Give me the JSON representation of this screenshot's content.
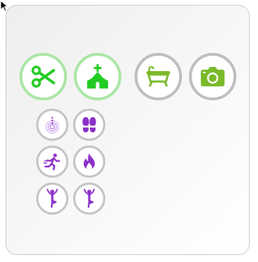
{
  "colors": {
    "active_icon": "#22cc22",
    "inactive_icon": "#7ab92a",
    "active_ring": "#a9e6a4",
    "inactive_ring": "#bdbdbd",
    "small_icon": "#8b2fc9",
    "small_ring": "#c3c3c3"
  },
  "large_buttons": [
    {
      "icon": "scissors-icon",
      "state": "active"
    },
    {
      "icon": "church-icon",
      "state": "active"
    },
    {
      "icon": "bathtub-icon",
      "state": "inactive"
    },
    {
      "icon": "camera-icon",
      "state": "inactive"
    }
  ],
  "small_buttons": [
    {
      "icon": "radar-icon"
    },
    {
      "icon": "footprints-icon"
    },
    {
      "icon": "running-person-icon"
    },
    {
      "icon": "flame-icon"
    },
    {
      "icon": "yoga-pose-icon"
    },
    {
      "icon": "yoga-pose-icon"
    }
  ]
}
